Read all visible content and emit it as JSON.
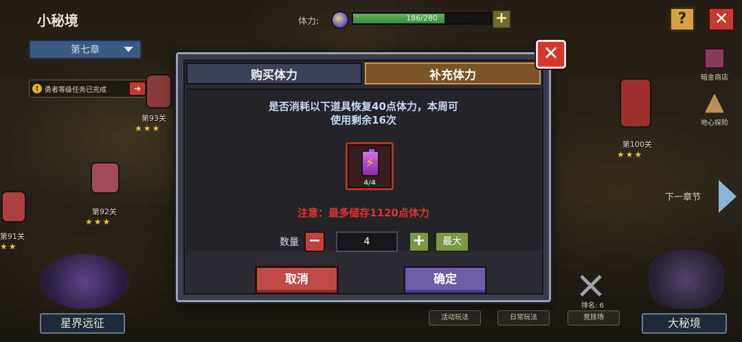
{
  "header": {
    "title": "小秘境",
    "chapter": "第七章",
    "stamina_label": "体力:",
    "stamina_text": "186/280",
    "stamina_fraction": 0.664
  },
  "quest_banner": "勇者等级任务已完成",
  "stages": [
    "第93关",
    "第92关",
    "第91关",
    "第100关"
  ],
  "side_menu": {
    "shop": "暗金商店",
    "cave": "地心探险"
  },
  "next_chapter": "下一章节",
  "bottom": {
    "left": "星界远征",
    "right": "大秘境",
    "activity": "活动玩法",
    "daily": "日常玩法",
    "arena": "竞技场",
    "rank": "排名: 6"
  },
  "dialog": {
    "tab_buy": "购买体力",
    "tab_refill": "补充体力",
    "desc_line1": "是否消耗以下道具恢复40点体力，本周可",
    "desc_line2": "使用剩余16次",
    "item_count": "4/4",
    "warning": "注意：最多储存1120点体力",
    "qty_label": "数量",
    "qty_value": "4",
    "max_label": "最大",
    "cancel": "取消",
    "confirm": "确定"
  }
}
